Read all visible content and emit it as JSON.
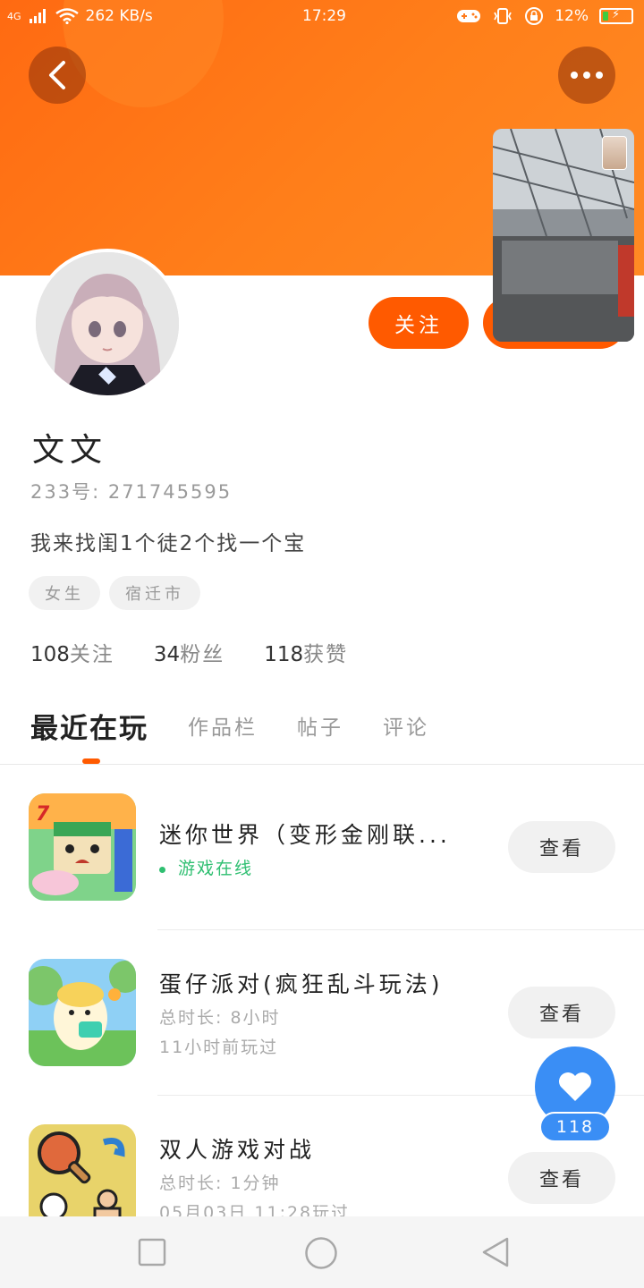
{
  "status_bar": {
    "network": "4G",
    "speed": "262 KB/s",
    "time": "17:29",
    "battery": "12%"
  },
  "profile": {
    "name": "文文",
    "uid": "233号: 271745595",
    "bio": "我来找闺1个徒2个找一个宝",
    "tags": [
      "女生",
      "宿迁市"
    ],
    "follow_label": "关注",
    "stats": {
      "following_count": "108",
      "following_label": "关注",
      "fans_count": "34",
      "fans_label": "粉丝",
      "likes_count": "118",
      "likes_label": "获赞"
    }
  },
  "tabs": [
    {
      "label": "最近在玩",
      "active": true
    },
    {
      "label": "作品栏",
      "active": false
    },
    {
      "label": "帖子",
      "active": false
    },
    {
      "label": "评论",
      "active": false
    }
  ],
  "games": [
    {
      "title": "迷你世界（变形金刚联...",
      "status": "游戏在线",
      "view_label": "查看"
    },
    {
      "title": "蛋仔派对(疯狂乱斗玩法)",
      "duration": "总时长: 8小时",
      "last_played": "11小时前玩过",
      "view_label": "查看"
    },
    {
      "title": "双人游戏对战",
      "duration": "总时长: 1分钟",
      "last_played": "05月03日 11:28玩过",
      "view_label": "查看"
    }
  ],
  "like_fab": {
    "count": "118"
  },
  "colors": {
    "accent": "#ff5a00",
    "header": "#ff7a1a",
    "online": "#2fbf71",
    "fab": "#3a8ef5"
  },
  "icons": [
    "back-icon",
    "more-icon",
    "heart-icon",
    "square-icon",
    "circle-icon",
    "triangle-back-icon"
  ]
}
